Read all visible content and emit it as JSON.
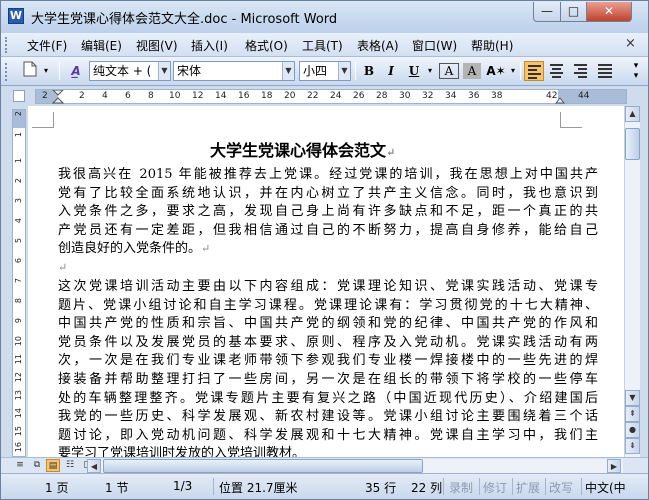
{
  "window": {
    "title": "大学生党课心得体会范文大全.doc - Microsoft Word",
    "app_icon": "W",
    "controls": {
      "minimize": "—",
      "maximize": "□",
      "close": "✕"
    }
  },
  "menubar": {
    "items": [
      "文件(F)",
      "编辑(E)",
      "视图(V)",
      "插入(I)",
      "格式(O)",
      "工具(T)",
      "表格(A)",
      "窗口(W)",
      "帮助(H)"
    ],
    "doc_close": "×"
  },
  "toolbar": {
    "style_value": "纯文本 + (",
    "font_value": "宋体",
    "size_value": "小四",
    "bold": "B",
    "italic": "I",
    "underline": "U",
    "char_border": "A",
    "char_shading": "A"
  },
  "ruler": {
    "h_numbers": [
      "2",
      "2",
      "4",
      "6",
      "8",
      "10",
      "12",
      "14",
      "16",
      "18",
      "20",
      "22",
      "24",
      "26",
      "28",
      "30",
      "32",
      "34",
      "36",
      "38",
      "42",
      "44"
    ],
    "v_numbers": [
      "2",
      "1",
      "1",
      "2",
      "3",
      "4",
      "5",
      "6",
      "7",
      "8",
      "9",
      "10",
      "11",
      "12",
      "13",
      "14",
      "15",
      "16"
    ]
  },
  "document": {
    "title": "大学生党课心得体会范文",
    "para1": [
      "我很高兴在 2015 年能被推荐去上党课。经过党课的培训，我在思想上对中国共产",
      "党有了比较全面系统地认识，并在内心树立了共产主义信念。同时，我也意识到",
      "入党条件之多，要求之高，发现自己身上尚有许多缺点和不足，距一个真正的共",
      "产党员还有一定差距，但我相信通过自己的不断努力，提高自身修养，能给自己",
      "创造良好的入党条件的。"
    ],
    "para2": [
      "这次党课培训活动主要由以下内容组成：党课理论知识、党课实践活动、党课专",
      "题片、党课小组讨论和自主学习课程。党课理论课有：学习贯彻党的十七大精神、",
      "中国共产党的性质和宗旨、中国共产党的纲领和党的纪律、中国共产党的作风和",
      "党员条件以及发展党员的基本要求、原则、程序及入党动机。党课实践活动有两",
      "次，一次是在我们专业课老师带领下参观我们专业楼一焊接楼中的一些先进的焊",
      "接装备并帮助整理打扫了一些房间，另一次是在组长的带领下将学校的一些停车",
      "处的车辆整理整齐。党课专题片主要有复兴之路（中国近现代历史）、介绍建国后",
      "我党的一些历史、科学发展观、新农村建设等。党课小组讨论主要围绕着三个话",
      "题讨论，即入党动机问题、科学发展观和十七大精神。党课自主学习中，我们主",
      "要学习了党课培训时发放的入党培训教材。"
    ],
    "para_mark": "↵"
  },
  "statusbar": {
    "page": "1 页",
    "section": "1 节",
    "page_of": "1/3",
    "position": "位置 21.7厘米",
    "line": "35 行",
    "column": "22 列",
    "rec": "录制",
    "trk": "修订",
    "ext": "扩展",
    "ovr": "改写",
    "language": "中文(中"
  }
}
